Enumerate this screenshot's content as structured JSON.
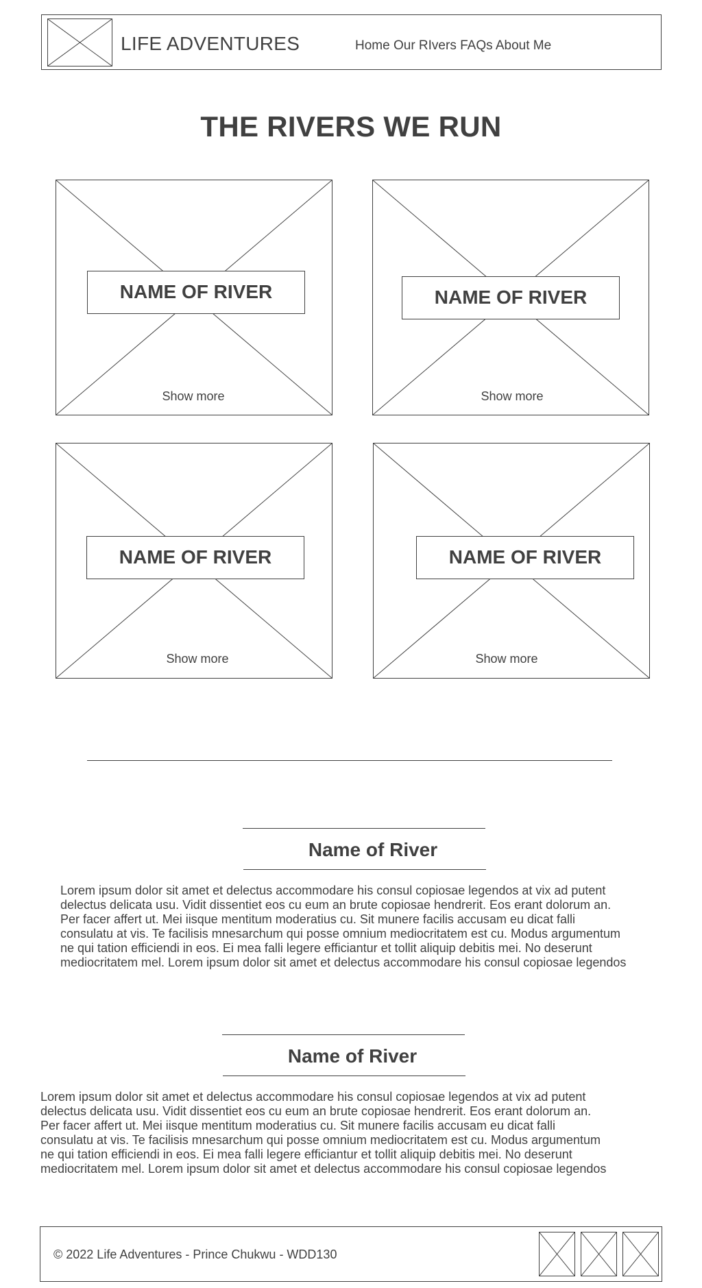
{
  "header": {
    "brand": "LIFE ADVENTURES",
    "nav": [
      "Home",
      "Our RIvers",
      "FAQs",
      "About Me"
    ]
  },
  "main": {
    "title": "THE RIVERS WE RUN",
    "cards": [
      {
        "name": "NAME OF RIVER",
        "more": "Show more"
      },
      {
        "name": "NAME OF RIVER",
        "more": "Show more"
      },
      {
        "name": "NAME OF RIVER",
        "more": "Show more"
      },
      {
        "name": "NAME OF RIVER",
        "more": "Show more"
      }
    ]
  },
  "sections": [
    {
      "title": "Name of River",
      "lines": [
        "Lorem ipsum dolor sit amet et delectus accommodare his consul copiosae legendos at vix ad putent",
        "delectus delicata usu. Vidit dissentiet eos cu eum an brute copiosae hendrerit. Eos erant dolorum an.",
        "Per facer affert ut. Mei iisque mentitum moderatius cu. Sit munere facilis accusam eu dicat falli",
        "consulatu at vis. Te facilisis mnesarchum qui posse omnium mediocritatem est cu. Modus argumentum",
        "ne qui tation efficiendi in eos. Ei mea falli legere efficiantur et tollit aliquip debitis mei. No deserunt",
        "mediocritatem mel. Lorem ipsum dolor sit amet et delectus accommodare his consul copiosae legendos"
      ]
    },
    {
      "title": "Name of River",
      "lines": [
        "Lorem ipsum dolor sit amet et delectus accommodare his consul copiosae legendos at vix ad putent",
        "delectus delicata usu. Vidit dissentiet eos cu eum an brute copiosae hendrerit. Eos erant dolorum an.",
        "Per facer affert ut. Mei iisque mentitum moderatius cu. Sit munere facilis accusam eu dicat falli",
        "consulatu at vis. Te facilisis mnesarchum qui posse omnium mediocritatem est cu. Modus argumentum",
        "ne qui tation efficiendi in eos. Ei mea falli legere efficiantur et tollit aliquip debitis mei. No deserunt",
        "mediocritatem mel. Lorem ipsum dolor sit amet et delectus accommodare his consul copiosae legendos"
      ]
    }
  ],
  "footer": {
    "copyright": "© 2022 Life Adventures - Prince Chukwu - WDD130",
    "social_icons": [
      "image-placeholder-icon",
      "image-placeholder-icon",
      "image-placeholder-icon"
    ]
  },
  "colors": {
    "line": "#404040",
    "background": "#ffffff"
  }
}
